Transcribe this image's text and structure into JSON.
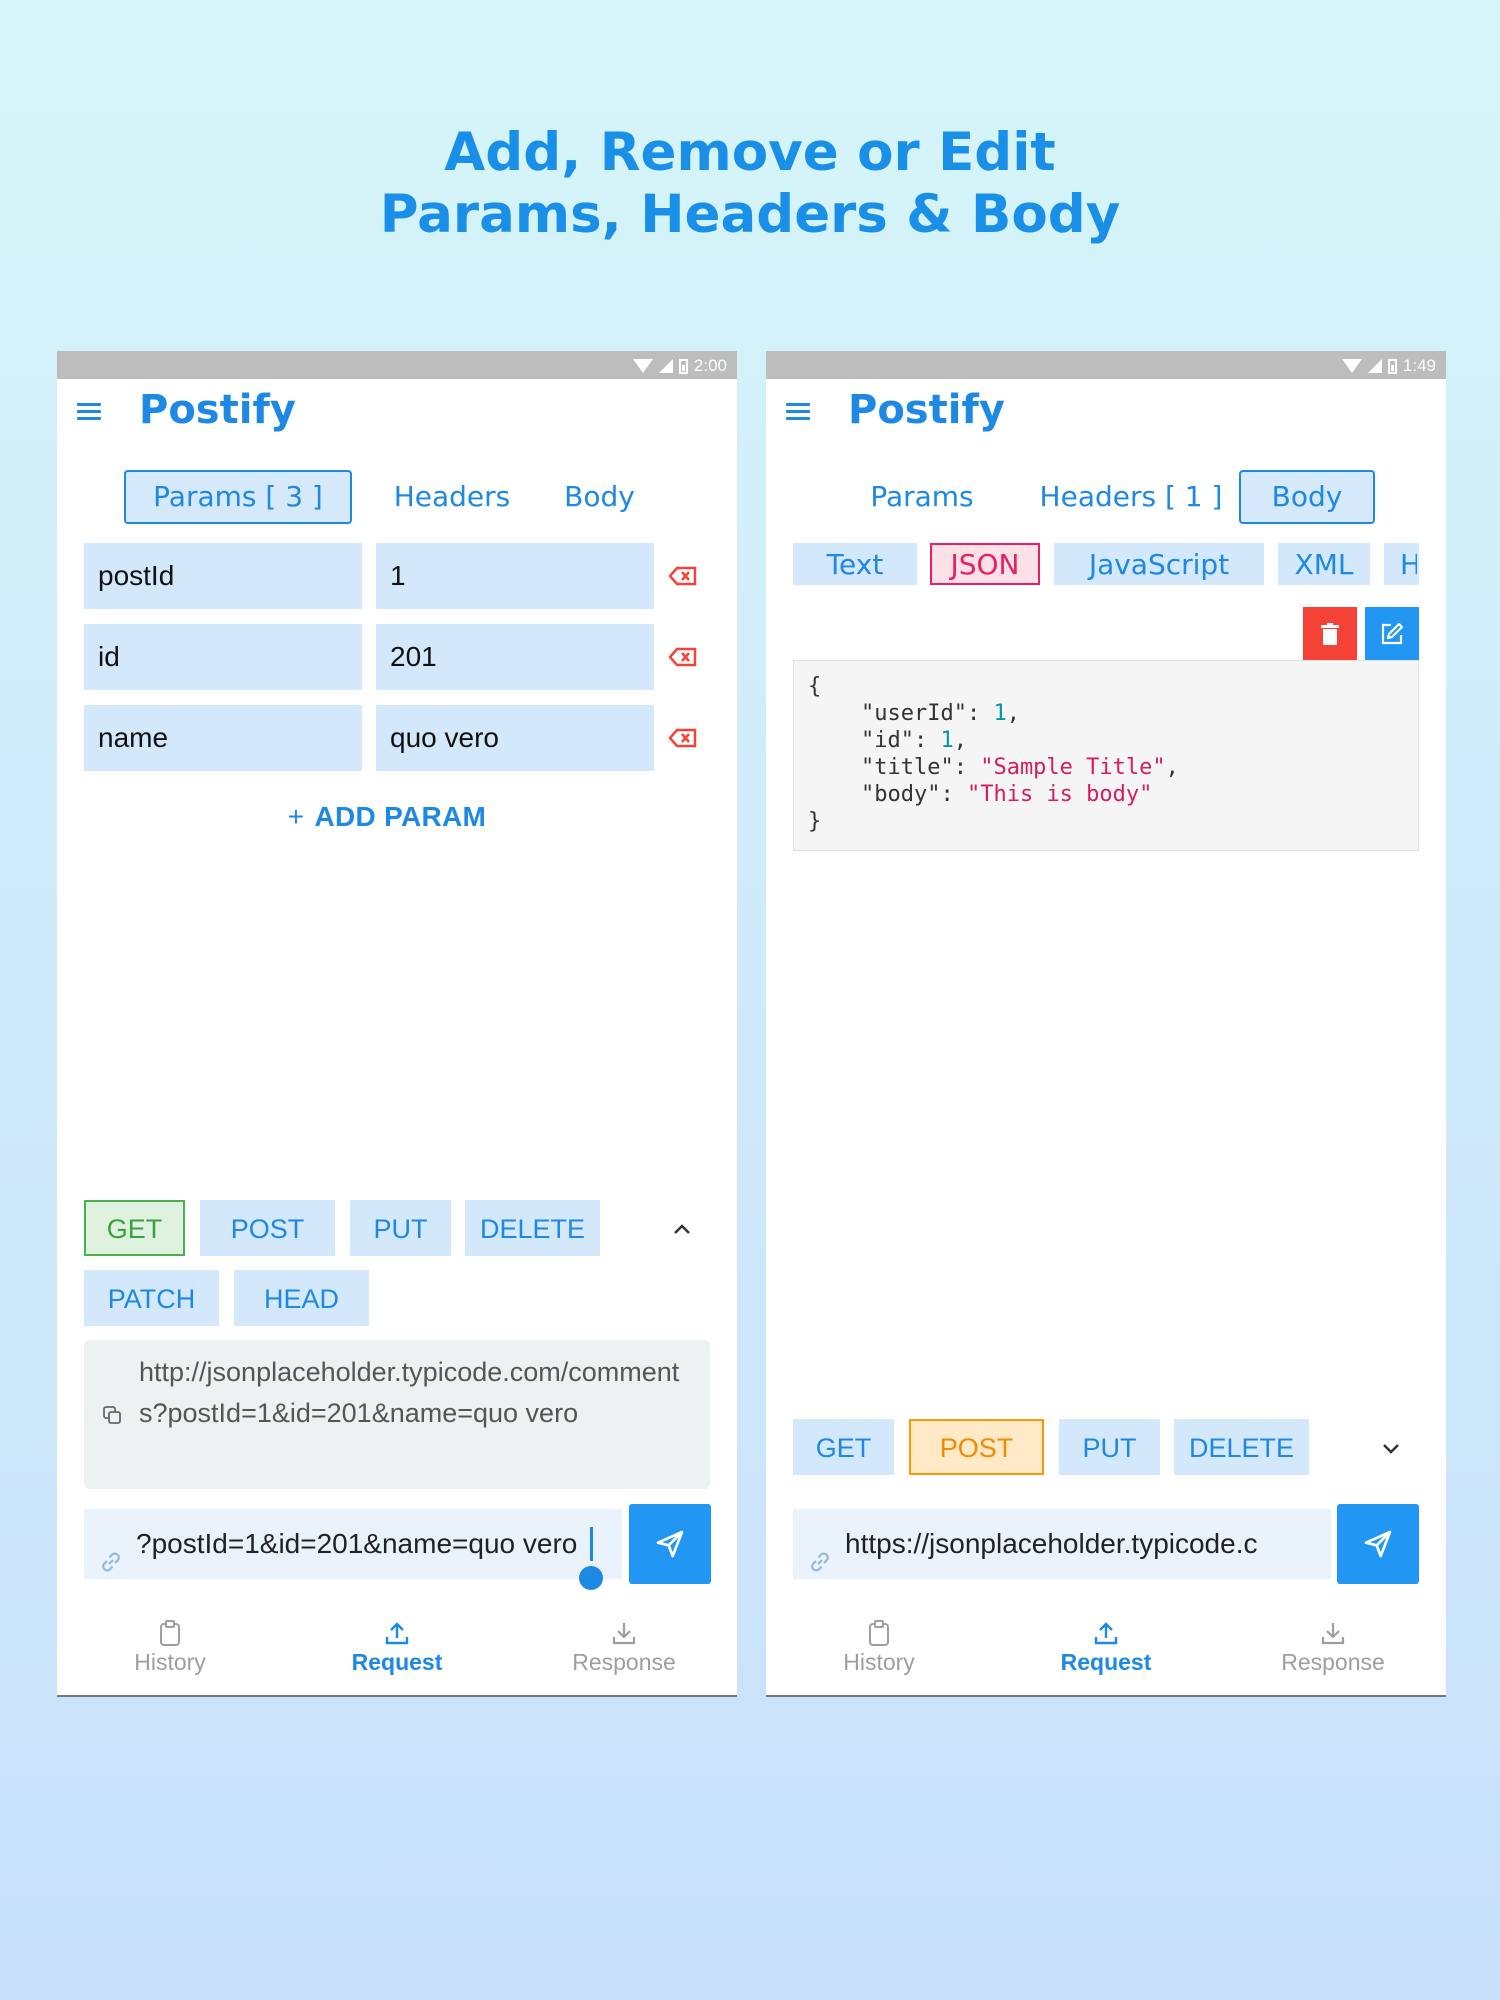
{
  "headline": {
    "line1": "Add, Remove or Edit",
    "line2": "Params, Headers & Body"
  },
  "left": {
    "status_time": "2:00",
    "app_title": "Postify",
    "tabs": [
      "Params [ 3 ]",
      "Headers",
      "Body"
    ],
    "params": [
      {
        "key": "postId",
        "value": "1"
      },
      {
        "key": "id",
        "value": "201"
      },
      {
        "key": "name",
        "value": "quo vero"
      }
    ],
    "add_param_label": "ADD PARAM",
    "methods": [
      "GET",
      "POST",
      "PUT",
      "DELETE",
      "PATCH",
      "HEAD"
    ],
    "selected_method": "GET",
    "url_preview": "http://jsonplaceholder.typicode.com/comments?postId=1&id=201&name=quo vero",
    "url_input_value": "?postId=1&id=201&name=quo vero"
  },
  "right": {
    "status_time": "1:49",
    "app_title": "Postify",
    "tabs": [
      "Params",
      "Headers [ 1 ]",
      "Body"
    ],
    "body_types": [
      "Text",
      "JSON",
      "JavaScript",
      "XML",
      "H"
    ],
    "selected_body_type": "JSON",
    "json": {
      "open": "{",
      "k1": "\"userId\"",
      "v1": "1",
      "k2": "\"id\"",
      "v2": "1",
      "k3": "\"title\"",
      "v3": "\"Sample Title\"",
      "k4": "\"body\"",
      "v4": "\"This is body\"",
      "close": "}"
    },
    "methods": [
      "GET",
      "POST",
      "PUT",
      "DELETE"
    ],
    "selected_method": "POST",
    "url_input_value": "https://jsonplaceholder.typicode.c"
  },
  "bottom_nav": [
    "History",
    "Request",
    "Response"
  ],
  "colors": {
    "accent": "#1e88e5",
    "get": "#4caf50",
    "post": "#ff9800",
    "json": "#e91e63",
    "delete": "#f44336"
  }
}
